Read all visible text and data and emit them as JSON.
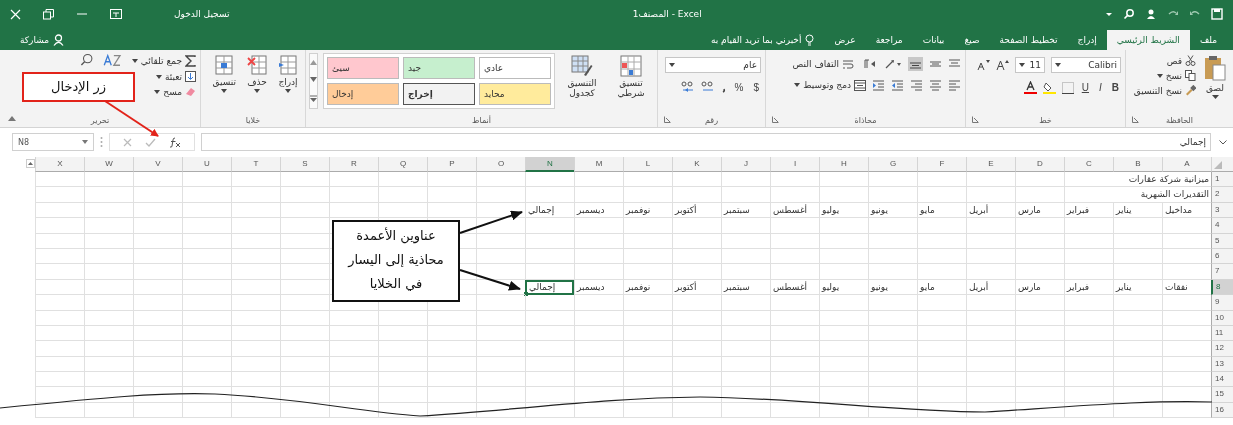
{
  "title_bar": {
    "title": "Excel - المصنف1",
    "sign_in": "تسجيل الدخول"
  },
  "tabs": [
    {
      "label": "ملف",
      "selected": false
    },
    {
      "label": "الشريط الرئيسي",
      "selected": true
    },
    {
      "label": "إدراج",
      "selected": false
    },
    {
      "label": "تخطيط الصفحة",
      "selected": false
    },
    {
      "label": "صيغ",
      "selected": false
    },
    {
      "label": "بيانات",
      "selected": false
    },
    {
      "label": "مراجعة",
      "selected": false
    },
    {
      "label": "عرض",
      "selected": false
    }
  ],
  "tell_me": "أخبرني بما تريد القيام به",
  "share": "مشاركة",
  "ribbon": {
    "clipboard": {
      "label": "الحافظة",
      "paste": "لصق",
      "cut": "قص",
      "copy": "نسخ",
      "format_painter": "نسخ التنسيق"
    },
    "font": {
      "label": "خط",
      "name": "Calibri",
      "size": "11",
      "bold": "B",
      "italic": "I",
      "underline": "U"
    },
    "alignment": {
      "label": "محاذاة",
      "wrap": "التفاف النص",
      "merge": "دمج وتوسيط"
    },
    "number": {
      "label": "رقم",
      "format": "عام",
      "currency": "$",
      "percent": "%"
    },
    "styles": {
      "label": "أنماط",
      "conditional": "تنسيق شرطي",
      "as_table": "التنسيق كجدول",
      "cell_styles": [
        {
          "name": "عادي",
          "color": "#ffffff"
        },
        {
          "name": "جيد",
          "color": "#c6efce"
        },
        {
          "name": "سيئ",
          "color": "#ffc7ce"
        },
        {
          "name": "محايد",
          "color": "#ffeb9c"
        },
        {
          "name": "إخراج",
          "color": "#f2f2f2"
        },
        {
          "name": "إدخال",
          "color": "#ffcc99"
        }
      ]
    },
    "cells": {
      "label": "خلايا",
      "items": [
        "إدراج",
        "حذف",
        "تنسيق"
      ]
    },
    "editing": {
      "label": "تحرير",
      "autosum": "جمع تلقائي",
      "fill": "تعبئة",
      "clear": "مسح"
    }
  },
  "formula_bar": {
    "name_box": "N8",
    "value": "إجمالي"
  },
  "grid": {
    "columns": [
      {
        "label": "A",
        "selected": false
      },
      {
        "label": "B",
        "selected": false
      },
      {
        "label": "C",
        "selected": false
      },
      {
        "label": "D",
        "selected": false
      },
      {
        "label": "E",
        "selected": false
      },
      {
        "label": "F",
        "selected": false
      },
      {
        "label": "G",
        "selected": false
      },
      {
        "label": "H",
        "selected": false
      },
      {
        "label": "I",
        "selected": false
      },
      {
        "label": "J",
        "selected": false
      },
      {
        "label": "K",
        "selected": false
      },
      {
        "label": "L",
        "selected": false
      },
      {
        "label": "M",
        "selected": false
      },
      {
        "label": "N",
        "selected": true
      },
      {
        "label": "O",
        "selected": false
      },
      {
        "label": "P",
        "selected": false
      },
      {
        "label": "Q",
        "selected": false
      },
      {
        "label": "R",
        "selected": false
      },
      {
        "label": "S",
        "selected": false
      },
      {
        "label": "T",
        "selected": false
      },
      {
        "label": "U",
        "selected": false
      },
      {
        "label": "V",
        "selected": false
      },
      {
        "label": "W",
        "selected": false
      },
      {
        "label": "X",
        "selected": false
      }
    ],
    "rows": [
      {
        "number": "1",
        "selected": false,
        "cells": [
          {
            "text": "ميزانية شركة عقارات",
            "selected": false
          }
        ]
      },
      {
        "number": "2",
        "selected": false,
        "cells": [
          {
            "text": "التقديرات الشهرية",
            "selected": false
          }
        ]
      },
      {
        "number": "3",
        "selected": false,
        "cells": [
          {
            "text": "مداخيل",
            "selected": false
          },
          {
            "text": "يناير",
            "selected": false
          },
          {
            "text": "فبراير",
            "selected": false
          },
          {
            "text": "مارس",
            "selected": false
          },
          {
            "text": "أبريل",
            "selected": false
          },
          {
            "text": "مايو",
            "selected": false
          },
          {
            "text": "يونيو",
            "selected": false
          },
          {
            "text": "يوليو",
            "selected": false
          },
          {
            "text": "أغسطس",
            "selected": false
          },
          {
            "text": "سبتمبر",
            "selected": false
          },
          {
            "text": "أكتوبر",
            "selected": false
          },
          {
            "text": "نوفمبر",
            "selected": false
          },
          {
            "text": "ديسمبر",
            "selected": false
          },
          {
            "text": "إجمالي",
            "selected": false
          }
        ]
      },
      {
        "number": "4",
        "selected": false
      },
      {
        "number": "5",
        "selected": false
      },
      {
        "number": "6",
        "selected": false
      },
      {
        "number": "7",
        "selected": false
      },
      {
        "number": "8",
        "selected": true,
        "cells": [
          {
            "text": "نفقات",
            "selected": false
          },
          {
            "text": "يناير",
            "selected": false
          },
          {
            "text": "فبراير",
            "selected": false
          },
          {
            "text": "مارس",
            "selected": false
          },
          {
            "text": "أبريل",
            "selected": false
          },
          {
            "text": "مايو",
            "selected": false
          },
          {
            "text": "يونيو",
            "selected": false
          },
          {
            "text": "يوليو",
            "selected": false
          },
          {
            "text": "أغسطس",
            "selected": false
          },
          {
            "text": "سبتمبر",
            "selected": false
          },
          {
            "text": "أكتوبر",
            "selected": false
          },
          {
            "text": "نوفمبر",
            "selected": false
          },
          {
            "text": "ديسمبر",
            "selected": false
          },
          {
            "text": "إجمالي",
            "selected": true
          }
        ]
      },
      {
        "number": "9",
        "selected": false
      },
      {
        "number": "10",
        "selected": false
      },
      {
        "number": "11",
        "selected": false
      },
      {
        "number": "12",
        "selected": false
      },
      {
        "number": "13",
        "selected": false
      },
      {
        "number": "14",
        "selected": false
      },
      {
        "number": "15",
        "selected": false
      },
      {
        "number": "16",
        "selected": false
      }
    ]
  },
  "callouts": [
    {
      "text": "زر الإدخال"
    },
    {
      "text": "عناوين الأعمدة محاذية إلى اليسار في الخلايا"
    }
  ]
}
